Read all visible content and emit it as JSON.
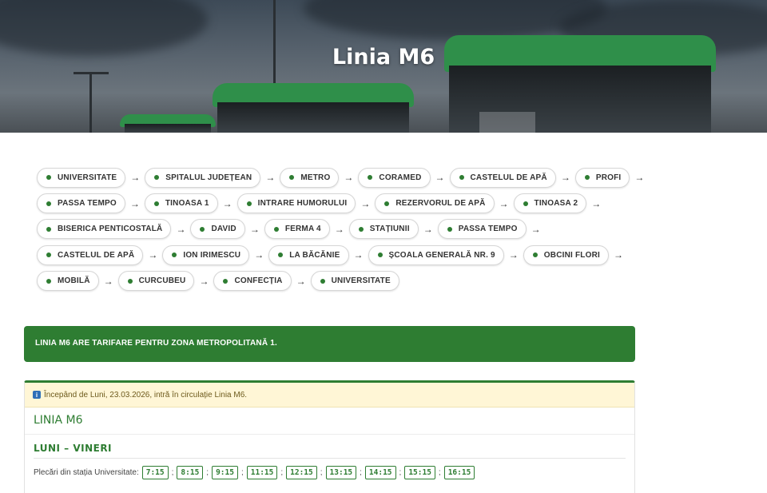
{
  "hero": {
    "title": "Linia M6"
  },
  "route": {
    "rows": [
      [
        "UNIVERSITATE",
        "SPITALUL JUDEȚEAN",
        "METRO",
        "CORAMED",
        "CASTELUL DE APĂ",
        "PROFI"
      ],
      [
        "PASSA TEMPO",
        "TINOASA 1",
        "INTRARE HUMORULUI",
        "REZERVORUL DE APĂ",
        "TINOASA 2"
      ],
      [
        "BISERICA PENTICOSTALĂ",
        "DAVID",
        "FERMA 4",
        "STAȚIUNII",
        "PASSA TEMPO"
      ],
      [
        "CASTELUL DE APĂ",
        "ION IRIMESCU",
        "LA BĂCĂNIE",
        "ȘCOALA GENERALĂ NR. 9",
        "OBCINI FLORI"
      ],
      [
        "MOBILĂ",
        "CURCUBEU",
        "CONFECȚIA",
        "UNIVERSITATE"
      ]
    ],
    "arrow": "→"
  },
  "zone": {
    "text": "LINIA M6 ARE TARIFARE PENTRU ZONA METROPOLITANĂ 1."
  },
  "schedule": {
    "notice": "Începând de Luni, 23.03.2026, intră în circulație Linia M6.",
    "notice_icon": "info-icon",
    "title": "LINIA M6",
    "days": "LUNI – VINERI",
    "departures_label": "Plecări din stația Universitate:",
    "times": [
      "7:15",
      "8:15",
      "9:15",
      "11:15",
      "12:15",
      "13:15",
      "14:15",
      "15:15",
      "16:15"
    ],
    "separator": ";"
  },
  "colors": {
    "accent": "#2e7d32",
    "notice_bg": "#fff6d6"
  }
}
